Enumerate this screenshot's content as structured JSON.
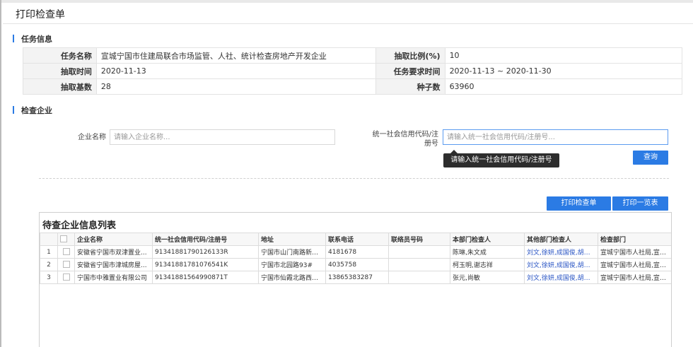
{
  "page": {
    "title": "打印检查单"
  },
  "task_section": {
    "heading": "任务信息"
  },
  "task_info": {
    "rows": [
      {
        "label1": "任务名称",
        "value1": "宣城宁国市住建局联合市场监管、人社、统计检查房地产开发企业",
        "label2": "抽取比例(%)",
        "value2": "10"
      },
      {
        "label1": "抽取时间",
        "value1": "2020-11-13",
        "label2": "任务要求时间",
        "value2": "2020-11-13 ~ 2020-11-30"
      },
      {
        "label1": "抽取基数",
        "value1": "28",
        "label2": "种子数",
        "value2": "63960"
      }
    ]
  },
  "check_section": {
    "heading": "检查企业"
  },
  "search": {
    "company_label": "企业名称",
    "company_placeholder": "请输入企业名称...",
    "credit_label_line1": "统一社会信用代码/注",
    "credit_label_line2": "册号",
    "credit_placeholder": "请输入统一社会信用代码/注册号...",
    "tooltip": "请输入统一社会信用代码/注册号",
    "query_button": "查询"
  },
  "actions": {
    "print_sheet": "打印检查单",
    "print_list": "打印一览表"
  },
  "grid": {
    "title": "待查企业信息列表",
    "columns": [
      "",
      "",
      "企业名称",
      "统一社会信用代码/注册号",
      "地址",
      "联系电话",
      "联络员号码",
      "本部门检查人",
      "其他部门检查人",
      "检查部门"
    ],
    "rows": [
      {
        "no": "1",
        "name": "安徽省宁国市双津置业...",
        "code": "91341881790126133R",
        "address": "宁国市山门南路新城...",
        "phone": "4181678",
        "liaison": "",
        "inspector": "陈琳,朱文成",
        "other": "刘文,徐妍,成国俊,胡叶...",
        "dept": "宣城宁国市人社局,宣城宁..."
      },
      {
        "no": "2",
        "name": "安徽省宁国市津城房屋...",
        "code": "91341881781076541K",
        "address": "宁国市北园路93#",
        "phone": "4035758",
        "liaison": "",
        "inspector": "柯玉明,谢志祥",
        "other": "刘文,徐妍,成国俊,胡叶林",
        "dept": "宣城宁国市人社局,宣城宁..."
      },
      {
        "no": "3",
        "name": "宁国市中雅置业有限公司",
        "code": "91341881564990871T",
        "address": "宁国市仙霞北路西侧...",
        "phone": "13865383287",
        "liaison": "",
        "inspector": "张元,尚敏",
        "other": "刘文,徐妍,成国俊,胡叶...",
        "dept": "宣城宁国市人社局,宣城宁..."
      }
    ]
  },
  "colors": {
    "accent": "#2b7be4",
    "link": "#2a55c4",
    "tooltip_bg": "#2d2d2d"
  }
}
